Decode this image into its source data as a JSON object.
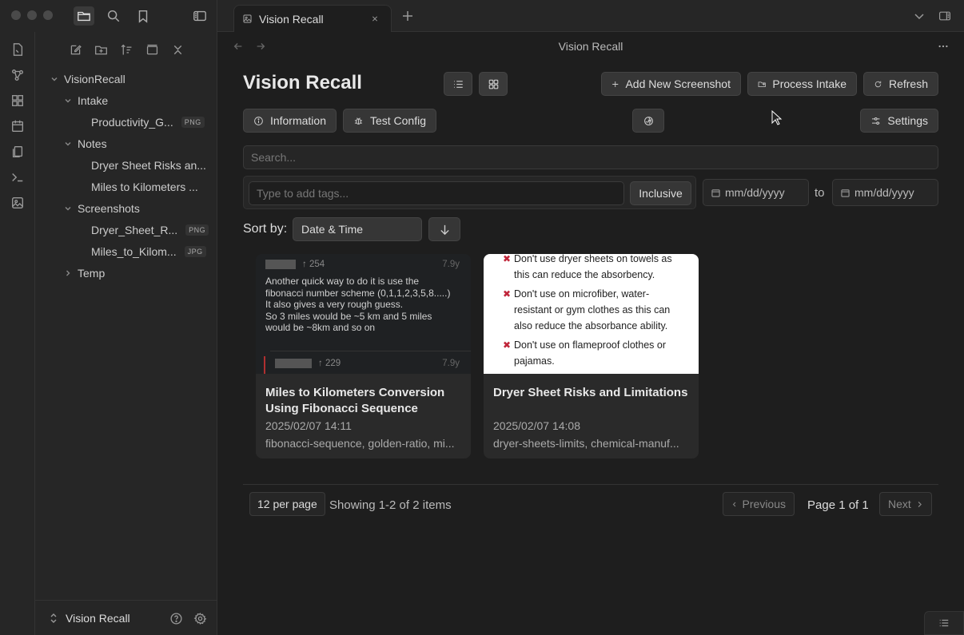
{
  "app": {
    "tab_title": "Vision Recall",
    "view_title": "Vision Recall",
    "vault_name": "Vision Recall"
  },
  "sidebar": {
    "tree": [
      {
        "label": "VisionRecall",
        "level": 0,
        "type": "folder",
        "expanded": true
      },
      {
        "label": "Intake",
        "level": 1,
        "type": "folder",
        "expanded": true
      },
      {
        "label": "Productivity_G...",
        "level": 2,
        "type": "file",
        "ext": "PNG"
      },
      {
        "label": "Notes",
        "level": 1,
        "type": "folder",
        "expanded": true
      },
      {
        "label": "Dryer Sheet Risks an...",
        "level": 2,
        "type": "file",
        "ext": ""
      },
      {
        "label": "Miles to Kilometers ...",
        "level": 2,
        "type": "file",
        "ext": ""
      },
      {
        "label": "Screenshots",
        "level": 1,
        "type": "folder",
        "expanded": true
      },
      {
        "label": "Dryer_Sheet_R...",
        "level": 2,
        "type": "file",
        "ext": "PNG"
      },
      {
        "label": "Miles_to_Kilom...",
        "level": 2,
        "type": "file",
        "ext": "JPG"
      },
      {
        "label": "Temp",
        "level": 1,
        "type": "folder",
        "expanded": false
      }
    ]
  },
  "main": {
    "title": "Vision Recall",
    "buttons": {
      "add": "Add New Screenshot",
      "process": "Process Intake",
      "refresh": "Refresh",
      "information": "Information",
      "test_config": "Test Config",
      "settings": "Settings"
    },
    "search_placeholder": "Search...",
    "tags_placeholder": "Type to add tags...",
    "inclusive": "Inclusive",
    "date_from": "mm/dd/yyyy",
    "date_to": "mm/dd/yyyy",
    "date_sep": "to",
    "sort_label": "Sort by:",
    "sort_value": "Date & Time"
  },
  "cards": [
    {
      "title": "Miles to Kilometers Conversion Using Fibonacci Sequence",
      "date": "2025/02/07 14:11",
      "tags": "fibonacci-sequence, golden-ratio, mi...",
      "thumb": {
        "score1": "↑ 254",
        "age1": "7.9y",
        "body": [
          "Another quick way to do it is use the",
          "fibonacci number scheme (0,1,1,2,3,5,8.....)",
          "It also gives a very rough guess.",
          "So 3 miles would be ~5 km and 5 miles",
          "would be ~8km and so on"
        ],
        "score2": "↑ 229",
        "age2": "7.9y"
      }
    },
    {
      "title": "Dryer Sheet Risks and Limitations",
      "date": "2025/02/07 14:08",
      "tags": "dryer-sheets-limits, chemical-manuf...",
      "thumb": {
        "items": [
          [
            "Don't use dryer sheets on towels as",
            "this can reduce the absorbency."
          ],
          [
            "Don't use on microfiber, water-",
            "resistant or gym clothes as this can",
            "also reduce the absorbance ability."
          ],
          [
            "Don't use on flameproof clothes or",
            "pajamas."
          ]
        ]
      }
    }
  ],
  "pagination": {
    "per_page": "12 per page",
    "showing": "Showing 1-2 of 2 items",
    "previous": "Previous",
    "page_info": "Page 1 of 1",
    "next": "Next"
  },
  "colors": {
    "background": "#1e1e1e",
    "sidebar": "#262626",
    "button": "#363636",
    "accent_red": "#c0263a"
  }
}
